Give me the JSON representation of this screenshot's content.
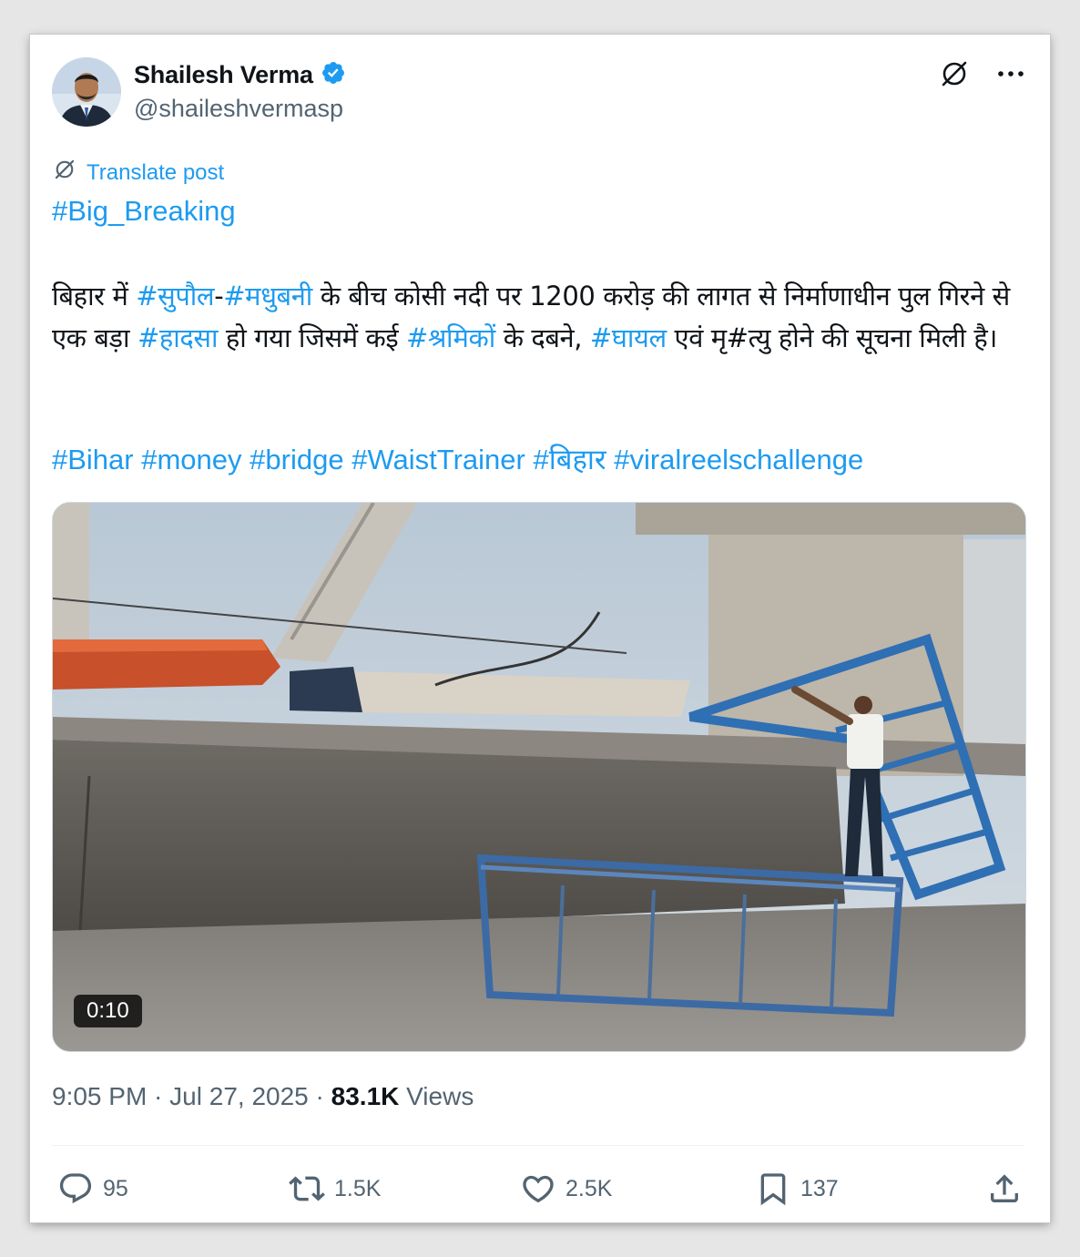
{
  "author": {
    "display_name": "Shailesh Verma",
    "handle": "@shaileshvermasp",
    "verified": true
  },
  "translate_label": "Translate post",
  "headline_tag": "#Big_Breaking",
  "body": {
    "p1": "बिहार में ",
    "tag1": "#सुपौल",
    "p2": "-",
    "tag2": "#मधुबनी",
    "p3": " के बीच कोसी नदी पर 1200 करोड़ की लागत से निर्माणाधीन पुल गिरने से एक बड़ा ",
    "tag3": "#हादसा",
    "p4": " हो गया जिसमें कई ",
    "tag4": "#श्रमिकों",
    "p5": " के दबने, ",
    "tag5": "#घायल",
    "p6": " एवं मृ#त्यु होने की सूचना मिली है।"
  },
  "hashtags": [
    "#Bihar",
    "#money",
    "#bridge",
    "#WaistTrainer",
    "#बिहार",
    "#viralreelschallenge"
  ],
  "video": {
    "duration": "0:10"
  },
  "meta": {
    "time": "9:05 PM",
    "separator": " · ",
    "date": "Jul 27, 2025",
    "views_count": "83.1K",
    "views_label": " Views"
  },
  "actions": {
    "replies": "95",
    "reposts": "1.5K",
    "likes": "2.5K",
    "bookmarks": "137"
  },
  "colors": {
    "link": "#1d9bf0",
    "secondary_text": "#536471",
    "verified_badge": "#1d9bf0"
  }
}
